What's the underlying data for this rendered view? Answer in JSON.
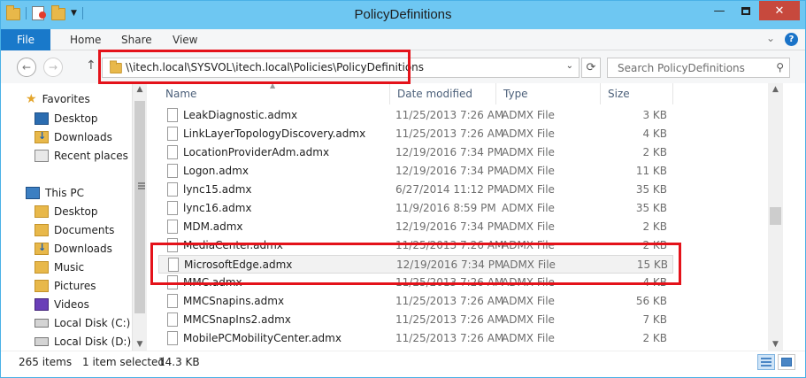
{
  "window": {
    "title": "PolicyDefinitions",
    "minimize_glyph": "—",
    "close_glyph": "✕"
  },
  "ribbon": {
    "file_tab": "File",
    "tabs": [
      "Home",
      "Share",
      "View"
    ],
    "expand_glyph": "⌄",
    "help_glyph": "?"
  },
  "nav": {
    "back_glyph": "←",
    "forward_glyph": "→",
    "up_glyph": "↑",
    "address": "\\\\itech.local\\SYSVOL\\itech.local\\Policies\\PolicyDefinitions",
    "address_dropdown_glyph": "⌄",
    "refresh_glyph": "⟳",
    "search_placeholder": "Search PolicyDefinitions",
    "search_icon_glyph": "⚲"
  },
  "sidebar": {
    "favorites": {
      "label": "Favorites",
      "icon": "star-icon"
    },
    "favorite_items": [
      {
        "label": "Desktop",
        "icon": "desktop-icon"
      },
      {
        "label": "Downloads",
        "icon": "downloads-icon"
      },
      {
        "label": "Recent places",
        "icon": "recent-places-icon"
      }
    ],
    "this_pc": {
      "label": "This PC",
      "icon": "computer-icon"
    },
    "pc_items": [
      {
        "label": "Desktop",
        "icon": "desktop-icon"
      },
      {
        "label": "Documents",
        "icon": "documents-icon"
      },
      {
        "label": "Downloads",
        "icon": "downloads-icon"
      },
      {
        "label": "Music",
        "icon": "music-icon"
      },
      {
        "label": "Pictures",
        "icon": "pictures-icon"
      },
      {
        "label": "Videos",
        "icon": "videos-icon"
      },
      {
        "label": "Local Disk (C:)",
        "icon": "disk-icon"
      },
      {
        "label": "Local Disk (D:)",
        "icon": "disk-icon"
      }
    ]
  },
  "columns": {
    "name": "Name",
    "date_modified": "Date modified",
    "type": "Type",
    "size": "Size"
  },
  "files": [
    {
      "name": "LeakDiagnostic.admx",
      "date": "11/25/2013 7:26 AM",
      "type": "ADMX File",
      "size": "3 KB"
    },
    {
      "name": "LinkLayerTopologyDiscovery.admx",
      "date": "11/25/2013 7:26 AM",
      "type": "ADMX File",
      "size": "4 KB"
    },
    {
      "name": "LocationProviderAdm.admx",
      "date": "12/19/2016 7:34 PM",
      "type": "ADMX File",
      "size": "2 KB"
    },
    {
      "name": "Logon.admx",
      "date": "12/19/2016 7:34 PM",
      "type": "ADMX File",
      "size": "11 KB"
    },
    {
      "name": "lync15.admx",
      "date": "6/27/2014 11:12 PM",
      "type": "ADMX File",
      "size": "35 KB"
    },
    {
      "name": "lync16.admx",
      "date": "11/9/2016 8:59 PM",
      "type": "ADMX File",
      "size": "35 KB"
    },
    {
      "name": "MDM.admx",
      "date": "12/19/2016 7:34 PM",
      "type": "ADMX File",
      "size": "2 KB"
    },
    {
      "name": "MediaCenter.admx",
      "date": "11/25/2013 7:26 AM",
      "type": "ADMX File",
      "size": "2 KB"
    },
    {
      "name": "MicrosoftEdge.admx",
      "date": "12/19/2016 7:34 PM",
      "type": "ADMX File",
      "size": "15 KB"
    },
    {
      "name": "MMC.admx",
      "date": "11/25/2013 7:26 AM",
      "type": "ADMX File",
      "size": "4 KB"
    },
    {
      "name": "MMCSnapins.admx",
      "date": "11/25/2013 7:26 AM",
      "type": "ADMX File",
      "size": "56 KB"
    },
    {
      "name": "MMCSnapIns2.admx",
      "date": "11/25/2013 7:26 AM",
      "type": "ADMX File",
      "size": "7 KB"
    },
    {
      "name": "MobilePCMobilityCenter.admx",
      "date": "11/25/2013 7:26 AM",
      "type": "ADMX File",
      "size": "2 KB"
    }
  ],
  "selected_file": "MicrosoftEdge.admx",
  "status": {
    "item_count": "265 items",
    "selection": "1 item selected",
    "selection_size": "14.3 KB"
  },
  "colors": {
    "titlebar": "#6ec7f2",
    "file_tab": "#1979ca",
    "close_button": "#c7493d",
    "highlight": "#e4121a"
  }
}
